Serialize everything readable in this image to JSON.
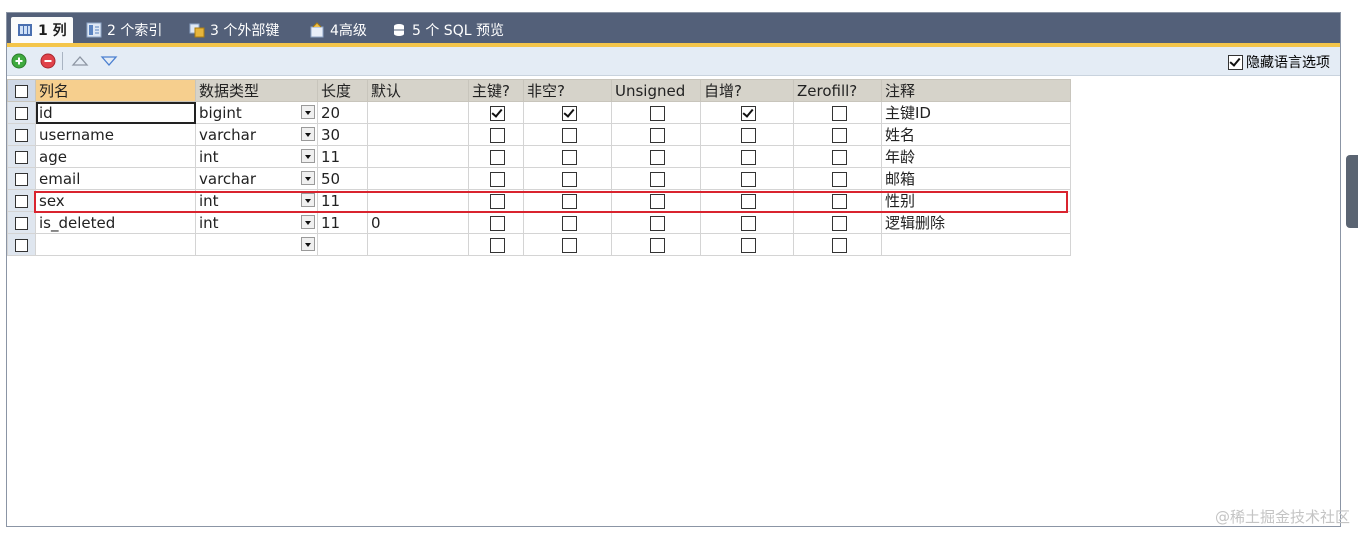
{
  "tabs": [
    {
      "label": "1 列",
      "icon": "columns-icon",
      "active": true
    },
    {
      "label": "2 个索引",
      "icon": "index-icon",
      "active": false
    },
    {
      "label": "3 个外部键",
      "icon": "foreign-key-icon",
      "active": false
    },
    {
      "label": "4高级",
      "icon": "advanced-icon",
      "active": false
    },
    {
      "label": "5 个 SQL 预览",
      "icon": "sql-preview-icon",
      "active": false
    }
  ],
  "toolbar": {
    "add_icon": "add-circle-icon",
    "remove_icon": "remove-circle-icon",
    "move_up_icon": "move-up-icon",
    "move_down_icon": "move-down-icon",
    "hide_language_label": "隐藏语言选项",
    "hide_language_checked": true
  },
  "grid": {
    "headers": [
      "列名",
      "数据类型",
      "长度",
      "默认",
      "主键?",
      "非空?",
      "Unsigned",
      "自增?",
      "Zerofill?",
      "注释"
    ],
    "rows": [
      {
        "name": "id",
        "type": "bigint",
        "length": "20",
        "default": "",
        "pk": true,
        "notnull": true,
        "unsigned": false,
        "autoinc": true,
        "zerofill": false,
        "comment": "主键ID"
      },
      {
        "name": "username",
        "type": "varchar",
        "length": "30",
        "default": "",
        "pk": false,
        "notnull": false,
        "unsigned": false,
        "autoinc": false,
        "zerofill": false,
        "comment": "姓名"
      },
      {
        "name": "age",
        "type": "int",
        "length": "11",
        "default": "",
        "pk": false,
        "notnull": false,
        "unsigned": false,
        "autoinc": false,
        "zerofill": false,
        "comment": "年龄"
      },
      {
        "name": "email",
        "type": "varchar",
        "length": "50",
        "default": "",
        "pk": false,
        "notnull": false,
        "unsigned": false,
        "autoinc": false,
        "zerofill": false,
        "comment": "邮箱"
      },
      {
        "name": "sex",
        "type": "int",
        "length": "11",
        "default": "",
        "pk": false,
        "notnull": false,
        "unsigned": false,
        "autoinc": false,
        "zerofill": false,
        "comment": "性别"
      },
      {
        "name": "is_deleted",
        "type": "int",
        "length": "11",
        "default": "0",
        "pk": false,
        "notnull": false,
        "unsigned": false,
        "autoinc": false,
        "zerofill": false,
        "comment": "逻辑删除"
      },
      {
        "name": "",
        "type": "",
        "length": "",
        "default": "",
        "pk": false,
        "notnull": false,
        "unsigned": false,
        "autoinc": false,
        "zerofill": false,
        "comment": ""
      }
    ]
  },
  "highlight_color": "#d9242f",
  "tab_bar_color": "#536079",
  "accent_color": "#f4c54a",
  "watermark": "@稀土掘金技术社区"
}
